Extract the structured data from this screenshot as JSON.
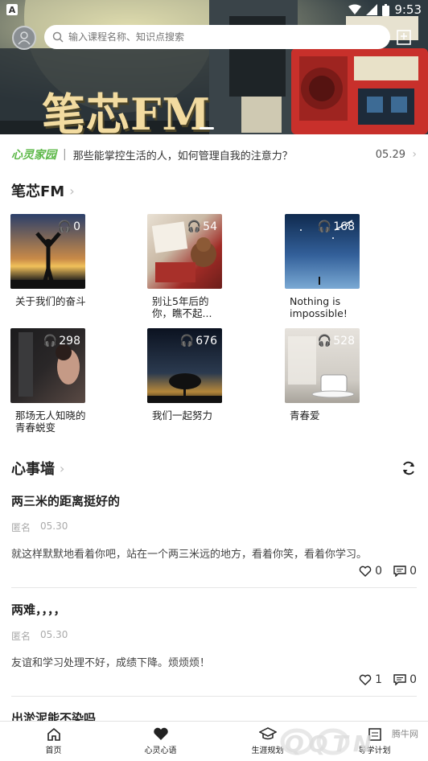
{
  "statusbar": {
    "left_icon": "a-icon",
    "time": "9:53"
  },
  "search": {
    "placeholder": "输入课程名称、知识点搜索"
  },
  "banner": {
    "title": "笔芯FM"
  },
  "notice": {
    "tag": "心灵家园",
    "separator": "|",
    "text": "那些能掌控生活的人，如何管理自我的注意力？",
    "date": "05.29"
  },
  "fm_section": {
    "title": "笔芯FM",
    "items": [
      {
        "caption": "关于我们的奋斗",
        "count": "0",
        "theme": "sunset"
      },
      {
        "caption": "别让5年后的你，瞧不起...",
        "count": "54",
        "theme": "christmas"
      },
      {
        "caption": "Nothing is impossible!",
        "count": "168",
        "theme": "starry"
      },
      {
        "caption": "那场无人知晓的青春蜕变",
        "count": "298",
        "theme": "night-girl"
      },
      {
        "caption": "我们一起努力",
        "count": "676",
        "theme": "tree-night"
      },
      {
        "caption": "青春爱",
        "count": "528",
        "theme": "coffee"
      }
    ]
  },
  "wall": {
    "title": "心事墙",
    "posts": [
      {
        "title": "两三米的距离挺好的",
        "author": "匿名",
        "date": "05.30",
        "body": "就这样默默地看着你吧，站在一个两三米远的地方，看着你笑，看着你学习。",
        "likes": "0",
        "comments": "0"
      },
      {
        "title": "两难，，，，",
        "author": "匿名",
        "date": "05.30",
        "body": "友谊和学习处理不好，成绩下降。烦烦烦！",
        "likes": "1",
        "comments": "0"
      },
      {
        "title": "出淤泥能不染吗"
      }
    ]
  },
  "tabbar": {
    "tabs": [
      {
        "label": "首页",
        "icon": "home-icon"
      },
      {
        "label": "心灵心语",
        "icon": "heart-icon"
      },
      {
        "label": "生涯规划",
        "icon": "grad-cap-icon"
      },
      {
        "label": "导学计划",
        "icon": "plan-icon"
      }
    ]
  },
  "watermark": {
    "brand": "QQTN",
    "site": "腾牛网"
  },
  "colors": {
    "accent_green": "#5cb848",
    "banner_dark": "#2d3940",
    "banner_red": "#c8302b",
    "title_gold": "#f2dba0"
  }
}
